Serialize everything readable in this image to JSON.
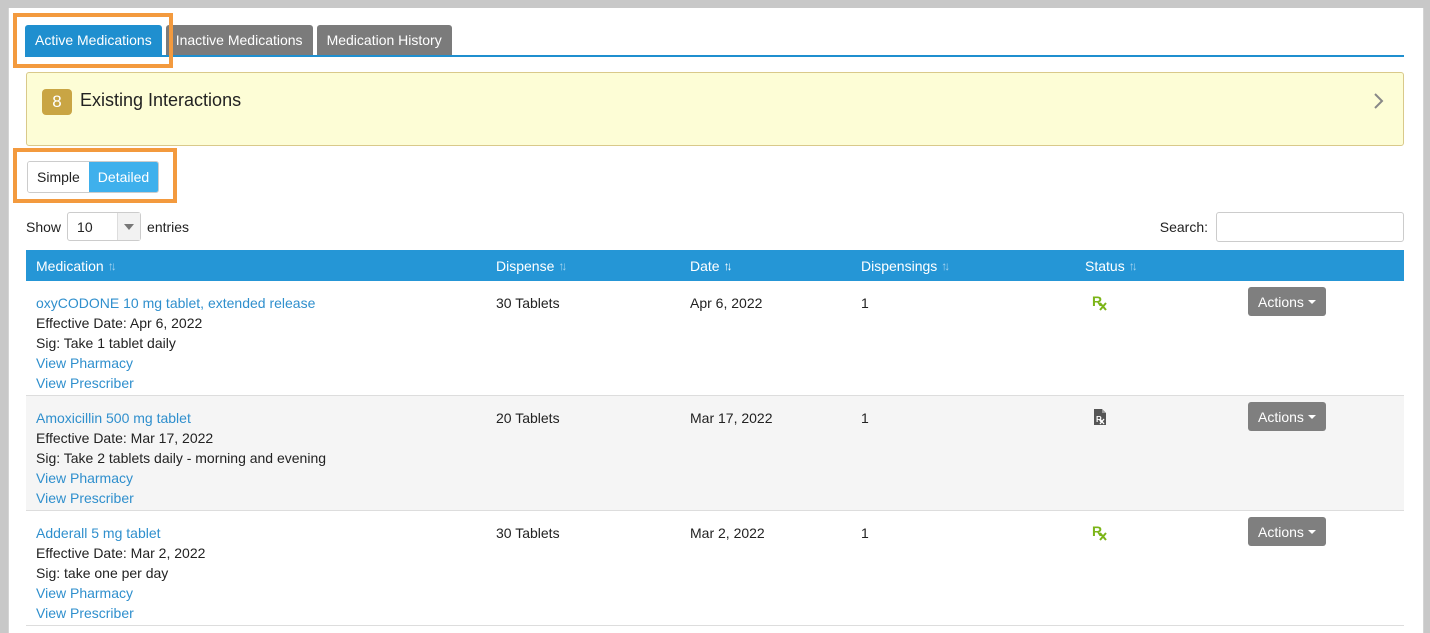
{
  "tabs": [
    {
      "label": "Active Medications",
      "active": true
    },
    {
      "label": "Inactive Medications",
      "active": false
    },
    {
      "label": "Medication History",
      "active": false
    }
  ],
  "interactions": {
    "count": "8",
    "label": "Existing Interactions"
  },
  "view_toggle": {
    "simple": "Simple",
    "detailed": "Detailed",
    "selected": "Detailed"
  },
  "length": {
    "show": "Show",
    "value": "10",
    "entries": "entries"
  },
  "search": {
    "label": "Search:",
    "value": ""
  },
  "table": {
    "headers": {
      "medication": "Medication",
      "dispense": "Dispense",
      "date": "Date",
      "dispensings": "Dispensings",
      "status": "Status"
    },
    "rows": [
      {
        "name": "oxyCODONE 10 mg tablet, extended release",
        "effective": "Effective Date: Apr 6, 2022",
        "sig": "Sig: Take 1 tablet daily",
        "pharmacy": "View Pharmacy",
        "prescriber": "View Prescriber",
        "dispense": "30 Tablets",
        "date": "Apr 6, 2022",
        "dispensings": "1",
        "status_icon": "rx-icon",
        "actions": "Actions"
      },
      {
        "name": "Amoxicillin 500 mg tablet",
        "effective": "Effective Date: Mar 17, 2022",
        "sig": "Sig: Take 2 tablets daily - morning and evening",
        "pharmacy": "View Pharmacy",
        "prescriber": "View Prescriber",
        "dispense": "20 Tablets",
        "date": "Mar 17, 2022",
        "dispensings": "1",
        "status_icon": "rx-document-icon",
        "actions": "Actions"
      },
      {
        "name": "Adderall 5 mg tablet",
        "effective": "Effective Date: Mar 2, 2022",
        "sig": "Sig: take one per day",
        "pharmacy": "View Pharmacy",
        "prescriber": "View Prescriber",
        "dispense": "30 Tablets",
        "date": "Mar 2, 2022",
        "dispensings": "1",
        "status_icon": "rx-icon",
        "actions": "Actions"
      }
    ]
  },
  "colors": {
    "primary": "#1f8fcf",
    "highlight": "#f39a3e",
    "rx_green": "#7cb518",
    "interaction_bg": "#fdfdd6"
  }
}
